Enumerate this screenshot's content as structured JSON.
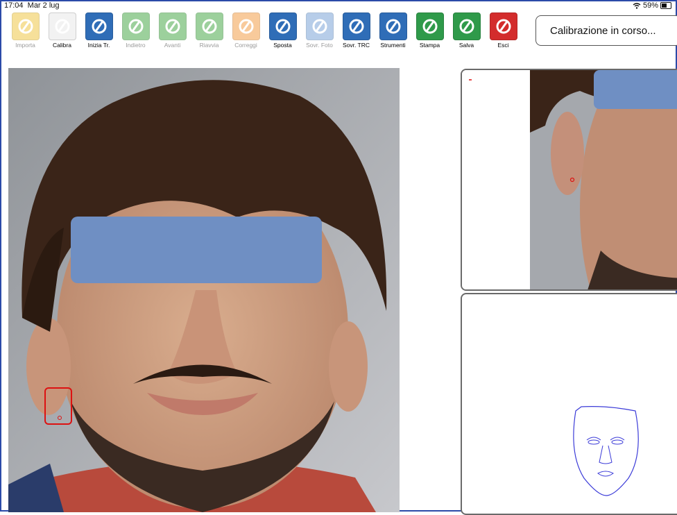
{
  "status_bar": {
    "time": "17:04",
    "date": "Mar 2 lug",
    "wifi": "wifi-icon",
    "battery": "59%"
  },
  "toolbar": [
    {
      "label": "Importa",
      "icon": "import-folder-icon",
      "color": "#f0c848",
      "enabled": false
    },
    {
      "label": "Calibra",
      "icon": "calibrate-ruler-icon",
      "color": "#f2f2f2",
      "enabled": true
    },
    {
      "label": "Inizia Tr.",
      "icon": "start-tracing-icon",
      "color": "#2f6db7",
      "enabled": true
    },
    {
      "label": "Indietro",
      "icon": "undo-arrow-icon",
      "color": "#4caa4c",
      "enabled": false
    },
    {
      "label": "Avanti",
      "icon": "redo-arrow-icon",
      "color": "#4caa4c",
      "enabled": false
    },
    {
      "label": "Riavvia",
      "icon": "restart-icon",
      "color": "#4caa4c",
      "enabled": false
    },
    {
      "label": "Correggi",
      "icon": "correct-icon",
      "color": "#f3a04a",
      "enabled": false
    },
    {
      "label": "Sposta",
      "icon": "move-arrows-icon",
      "color": "#2f6db7",
      "enabled": true
    },
    {
      "label": "Sovr. Foto",
      "icon": "overlay-photo-icon",
      "color": "#7ea6d8",
      "enabled": false
    },
    {
      "label": "Sovr. TRC",
      "icon": "overlay-trc-icon",
      "color": "#2f6db7",
      "enabled": true
    },
    {
      "label": "Strumenti",
      "icon": "tools-wand-icon",
      "color": "#2f6db7",
      "enabled": true
    },
    {
      "label": "Stampa",
      "icon": "printer-icon",
      "color": "#2f9a4a",
      "enabled": true
    },
    {
      "label": "Salva",
      "icon": "save-check-icon",
      "color": "#2f9a4a",
      "enabled": true
    },
    {
      "label": "Esci",
      "icon": "exit-door-icon",
      "color": "#d32c2c",
      "enabled": true
    }
  ],
  "status_message": "Calibrazione in corso...",
  "colors": {
    "frame": "#2b4aa8",
    "marker": "#dd1111",
    "mask": "#6f8fc3",
    "trace": "#3b3bd8"
  }
}
